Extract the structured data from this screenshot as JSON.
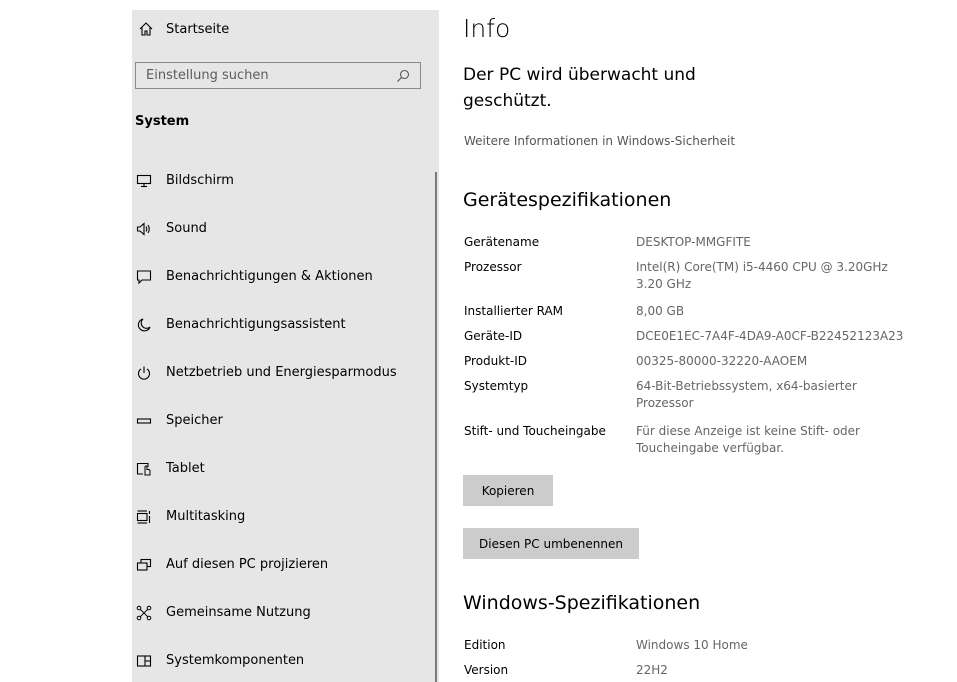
{
  "sidebar": {
    "home_label": "Startseite",
    "search_placeholder": "Einstellung suchen",
    "section_title": "System",
    "items": [
      {
        "label": "Bildschirm",
        "icon": "monitor-icon"
      },
      {
        "label": "Sound",
        "icon": "speaker-icon"
      },
      {
        "label": "Benachrichtigungen & Aktionen",
        "icon": "notification-icon"
      },
      {
        "label": "Benachrichtigungsassistent",
        "icon": "moon-icon"
      },
      {
        "label": "Netzbetrieb und Energiesparmodus",
        "icon": "power-icon"
      },
      {
        "label": "Speicher",
        "icon": "storage-icon"
      },
      {
        "label": "Tablet",
        "icon": "tablet-icon"
      },
      {
        "label": "Multitasking",
        "icon": "multitasking-icon"
      },
      {
        "label": "Auf diesen PC projizieren",
        "icon": "project-icon"
      },
      {
        "label": "Gemeinsame Nutzung",
        "icon": "share-icon"
      },
      {
        "label": "Systemkomponenten",
        "icon": "components-icon"
      }
    ]
  },
  "main": {
    "title": "Info",
    "protected_text": "Der PC wird überwacht und geschützt.",
    "security_link": "Weitere Informationen in Windows-Sicherheit",
    "device_specs_title": "Gerätespezifikationen",
    "device_specs": [
      {
        "key": "Gerätename",
        "value": "DESKTOP-MMGFITE"
      },
      {
        "key": "Prozessor",
        "value": "Intel(R) Core(TM) i5-4460  CPU @ 3.20GHz   3.20 GHz"
      },
      {
        "key": "Installierter RAM",
        "value": "8,00 GB"
      },
      {
        "key": "Geräte-ID",
        "value": "DCE0E1EC-7A4F-4DA9-A0CF-B22452123A23"
      },
      {
        "key": "Produkt-ID",
        "value": "00325-80000-32220-AAOEM"
      },
      {
        "key": "Systemtyp",
        "value": "64-Bit-Betriebssystem, x64-basierter Prozessor"
      },
      {
        "key": "Stift- und Toucheingabe",
        "value": "Für diese Anzeige ist keine Stift- oder Toucheingabe verfügbar."
      }
    ],
    "copy_button": "Kopieren",
    "rename_button": "Diesen PC umbenennen",
    "windows_specs_title": "Windows-Spezifikationen",
    "windows_specs": [
      {
        "key": "Edition",
        "value": "Windows 10 Home"
      },
      {
        "key": "Version",
        "value": "22H2"
      }
    ]
  }
}
